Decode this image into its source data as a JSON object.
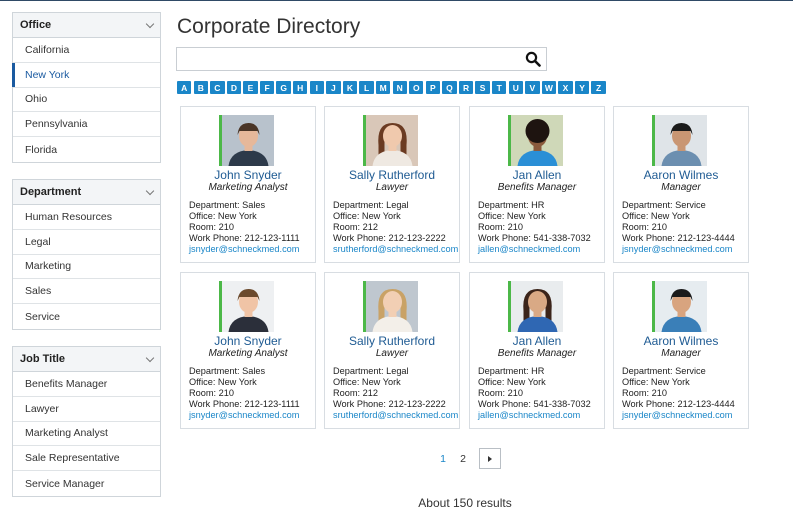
{
  "sidebar": {
    "facets": [
      {
        "title": "Office",
        "items": [
          "California",
          "New York",
          "Ohio",
          "Pennsylvania",
          "Florida"
        ],
        "active": "New York"
      },
      {
        "title": "Department",
        "items": [
          "Human Resources",
          "Legal",
          "Marketing",
          "Sales",
          "Service"
        ]
      },
      {
        "title": "Job Title",
        "items": [
          "Benefits Manager",
          "Lawyer",
          "Marketing Analyst",
          "Sale Representative",
          "Service Manager"
        ]
      }
    ]
  },
  "main": {
    "title": "Corporate Directory",
    "search": {
      "value": "",
      "placeholder": ""
    },
    "alphabet": [
      "A",
      "B",
      "C",
      "D",
      "E",
      "F",
      "G",
      "H",
      "I",
      "J",
      "K",
      "L",
      "M",
      "N",
      "O",
      "P",
      "Q",
      "R",
      "S",
      "T",
      "U",
      "V",
      "W",
      "X",
      "Y",
      "Z"
    ],
    "cards": [
      {
        "name": "John Snyder",
        "title": "Marketing Analyst",
        "department": "Department: Sales",
        "office": "Office: New York",
        "room": "Room: 210",
        "phone": "Work Phone: 212-123-1111",
        "email": "jsnyder@schneckmed.com"
      },
      {
        "name": "Sally Rutherford",
        "title": "Lawyer",
        "department": "Department: Legal",
        "office": "Office: New York",
        "room": "Room: 212",
        "phone": "Work Phone: 212-123-2222",
        "email": "srutherford@schneckmed.com"
      },
      {
        "name": "Jan Allen",
        "title": "Benefits Manager",
        "department": "Department: HR",
        "office": "Office: New York",
        "room": "Room: 210",
        "phone": "Work Phone: 541-338-7032",
        "email": "jallen@schneckmed.com"
      },
      {
        "name": "Aaron Wilmes",
        "title": "Manager",
        "department": "Department: Service",
        "office": "Office: New York",
        "room": "Room: 210",
        "phone": "Work Phone: 212-123-4444",
        "email": "jsnyder@schneckmed.com"
      },
      {
        "name": "John Snyder",
        "title": "Marketing Analyst",
        "department": "Department: Sales",
        "office": "Office: New York",
        "room": "Room: 210",
        "phone": "Work Phone: 212-123-1111",
        "email": "jsnyder@schneckmed.com"
      },
      {
        "name": "Sally Rutherford",
        "title": "Lawyer",
        "department": "Department: Legal",
        "office": "Office: New York",
        "room": "Room: 212",
        "phone": "Work Phone: 212-123-2222",
        "email": "srutherford@schneckmed.com"
      },
      {
        "name": "Jan Allen",
        "title": "Benefits Manager",
        "department": "Department: HR",
        "office": "Office: New York",
        "room": "Room: 210",
        "phone": "Work Phone: 541-338-7032",
        "email": "jallen@schneckmed.com"
      },
      {
        "name": "Aaron Wilmes",
        "title": "Manager",
        "department": "Department: Service",
        "office": "Office: New York",
        "room": "Room: 210",
        "phone": "Work Phone: 212-123-4444",
        "email": "jsnyder@schneckmed.com"
      }
    ],
    "pagination": {
      "current": "1",
      "next_page": "2",
      "next_icon": "chevron-right-icon"
    },
    "results_text": "About 150 results"
  },
  "colors": {
    "accent": "#1a86c8",
    "link": "#1f5b93",
    "photo_bar": "#4cb848",
    "active_facet": "#1a5aa0"
  }
}
